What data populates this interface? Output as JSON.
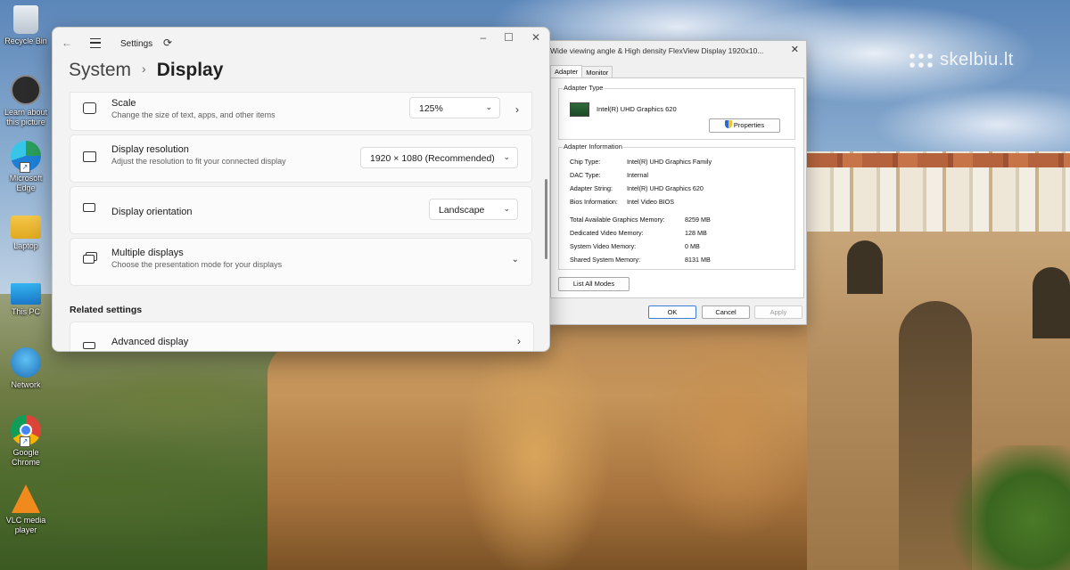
{
  "desktop": {
    "watermark": "skelbiu.lt",
    "icons": [
      {
        "label": "Recycle Bin",
        "icon": "recycle-bin-icon"
      },
      {
        "label": "Learn about this picture",
        "icon": "learn-icon"
      },
      {
        "label": "Microsoft Edge",
        "icon": "edge-icon"
      },
      {
        "label": "Laptop",
        "icon": "folder-icon"
      },
      {
        "label": "This PC",
        "icon": "monitor-icon"
      },
      {
        "label": "Network",
        "icon": "network-icon"
      },
      {
        "label": "Google Chrome",
        "icon": "chrome-icon"
      },
      {
        "label": "VLC media player",
        "icon": "vlc-icon"
      }
    ]
  },
  "settings": {
    "window_title": "Settings",
    "breadcrumb_parent": "System",
    "breadcrumb_sep": "›",
    "page_title": "Display",
    "rows": {
      "scale": {
        "title": "Scale",
        "subtitle": "Change the size of text, apps, and other items",
        "value": "125%"
      },
      "resolution": {
        "title": "Display resolution",
        "subtitle": "Adjust the resolution to fit your connected display",
        "value": "1920 × 1080 (Recommended)"
      },
      "orientation": {
        "title": "Display orientation",
        "value": "Landscape"
      },
      "multiple": {
        "title": "Multiple displays",
        "subtitle": "Choose the presentation mode for your displays"
      }
    },
    "related_heading": "Related settings",
    "advanced_title": "Advanced display"
  },
  "adapter": {
    "window_title": "Wide viewing angle & High density FlexView Display 1920x10...",
    "tabs": [
      "Adapter",
      "Monitor"
    ],
    "adapter_type_label": "Adapter Type",
    "adapter_name": "Intel(R) UHD Graphics 620",
    "properties_button": "Properties",
    "adapter_info_label": "Adapter Information",
    "info": [
      {
        "key": "Chip Type:",
        "value": "Intel(R) UHD Graphics Family"
      },
      {
        "key": "DAC Type:",
        "value": "Internal"
      },
      {
        "key": "Adapter String:",
        "value": "Intel(R) UHD Graphics 620"
      },
      {
        "key": "Bios Information:",
        "value": "Intel Video BIOS"
      }
    ],
    "memory": [
      {
        "key": "Total Available Graphics Memory:",
        "value": "8259 MB"
      },
      {
        "key": "Dedicated Video Memory:",
        "value": "128 MB"
      },
      {
        "key": "System Video Memory:",
        "value": "0 MB"
      },
      {
        "key": "Shared System Memory:",
        "value": "8131 MB"
      }
    ],
    "list_modes_button": "List All Modes",
    "ok_button": "OK",
    "cancel_button": "Cancel",
    "apply_button": "Apply"
  }
}
